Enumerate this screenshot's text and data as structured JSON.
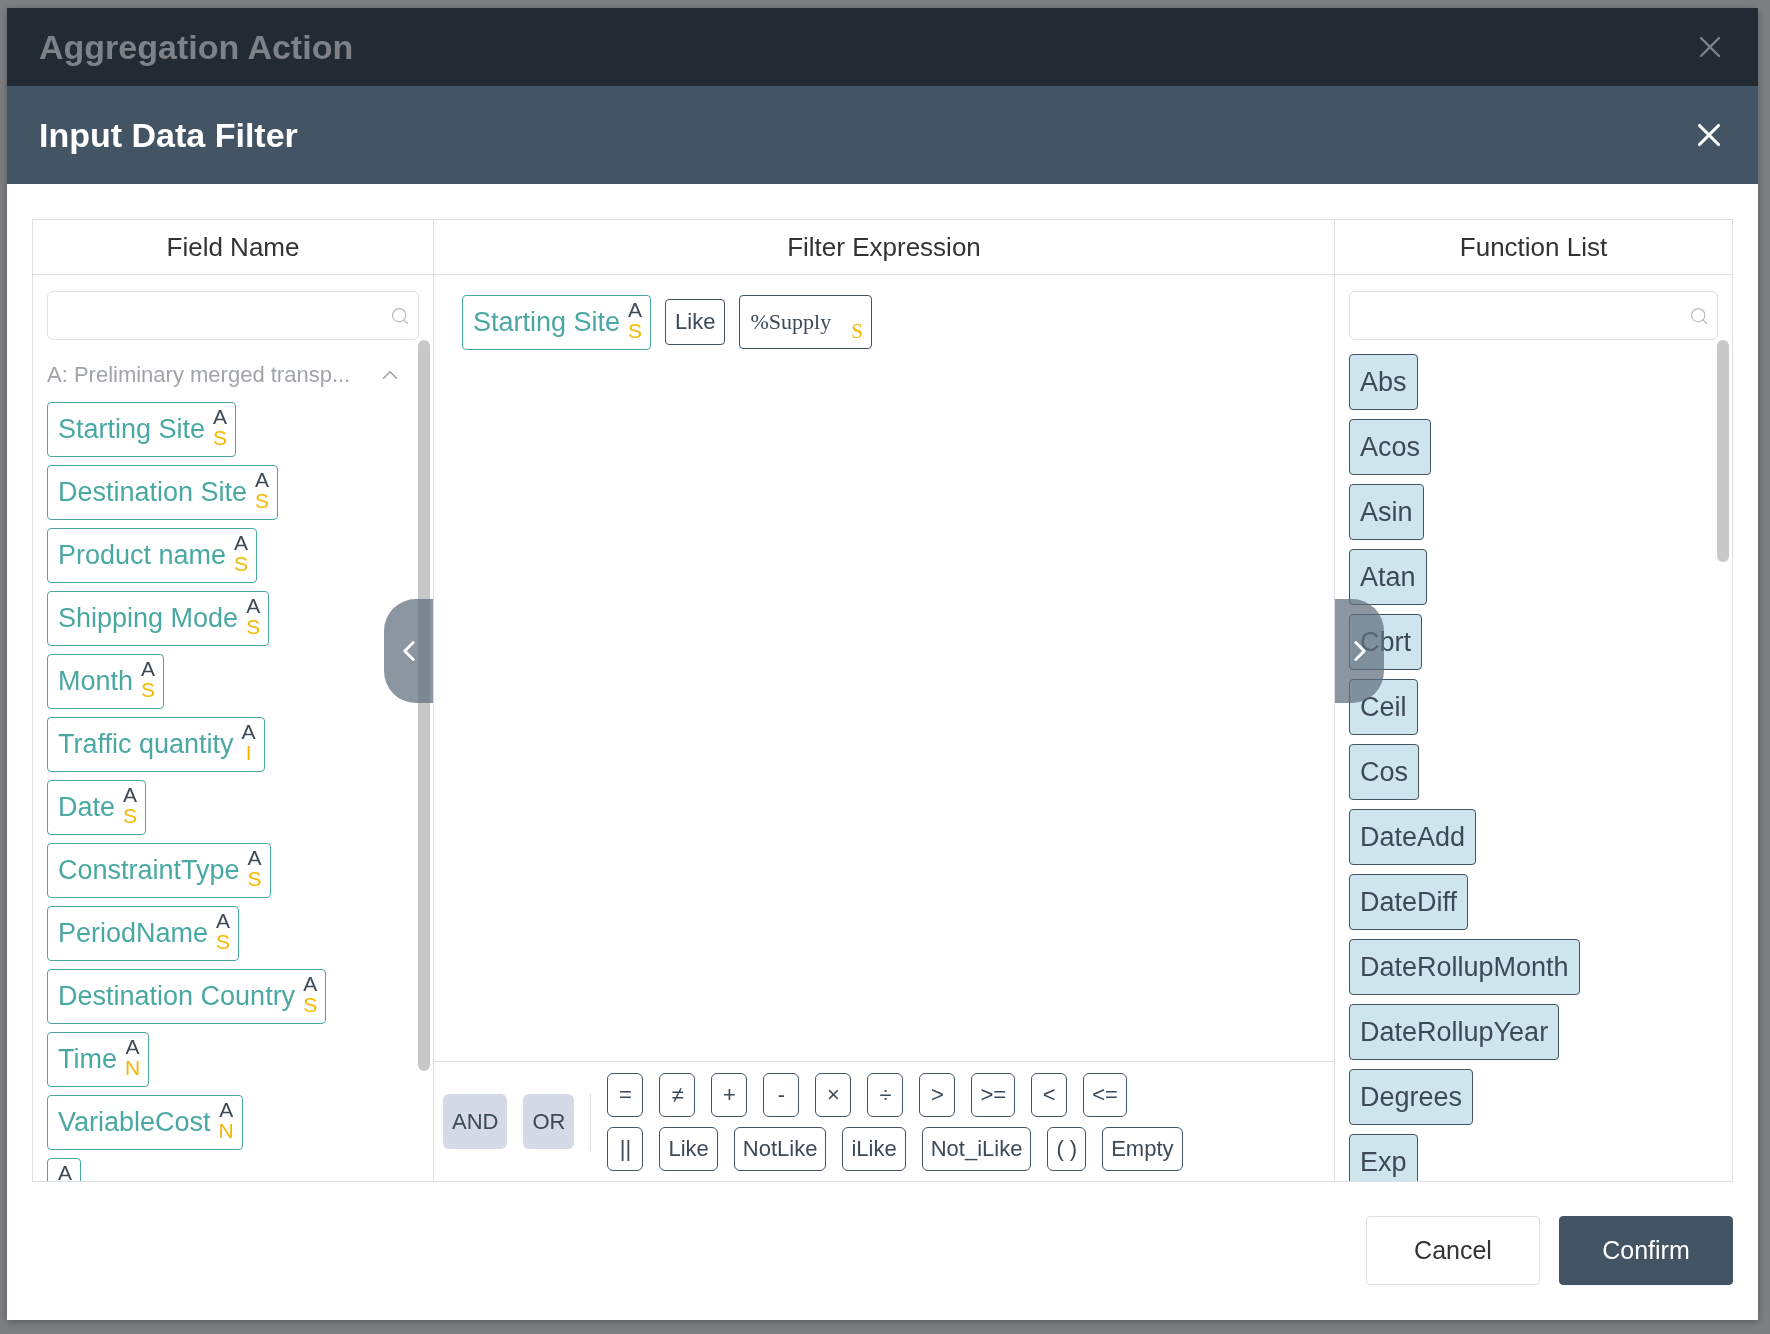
{
  "window": {
    "title": "Aggregation Action"
  },
  "dialog": {
    "title": "Input Data Filter"
  },
  "field_panel": {
    "heading": "Field Name",
    "group": {
      "label": "A: Preliminary merged transp...",
      "expanded": true
    },
    "fields": [
      {
        "name": "Starting Site",
        "source": "A",
        "type": "S"
      },
      {
        "name": "Destination Site",
        "source": "A",
        "type": "S"
      },
      {
        "name": "Product name",
        "source": "A",
        "type": "S"
      },
      {
        "name": "Shipping Mode",
        "source": "A",
        "type": "S"
      },
      {
        "name": "Month",
        "source": "A",
        "type": "S"
      },
      {
        "name": "Traffic quantity",
        "source": "A",
        "type": "I"
      },
      {
        "name": "Date",
        "source": "A",
        "type": "S"
      },
      {
        "name": "ConstraintType",
        "source": "A",
        "type": "S"
      },
      {
        "name": "PeriodName",
        "source": "A",
        "type": "S"
      },
      {
        "name": "Destination Country",
        "source": "A",
        "type": "S"
      },
      {
        "name": "Time",
        "source": "A",
        "type": "N"
      },
      {
        "name": "VariableCost",
        "source": "A",
        "type": "N"
      },
      {
        "source": "A"
      }
    ]
  },
  "expression": {
    "heading": "Filter Expression",
    "tokens": [
      {
        "kind": "field",
        "text": "Starting Site",
        "source": "A",
        "type": "S"
      },
      {
        "kind": "operator",
        "text": "Like"
      },
      {
        "kind": "value",
        "text": "%Supply",
        "type": "S"
      }
    ],
    "logic_buttons": [
      "AND",
      "OR"
    ],
    "operator_rows": [
      [
        "=",
        "≠",
        "+",
        "-",
        "×",
        "÷",
        ">",
        ">=",
        "<",
        "<="
      ],
      [
        "||",
        "Like",
        "NotLike",
        "iLike",
        "Not_iLike",
        "( )",
        "Empty"
      ]
    ]
  },
  "function_panel": {
    "heading": "Function List",
    "functions": [
      "Abs",
      "Acos",
      "Asin",
      "Atan",
      "Cbrt",
      "Ceil",
      "Cos",
      "DateAdd",
      "DateDiff",
      "DateRollupMonth",
      "DateRollupYear",
      "Degrees",
      "Exp"
    ]
  },
  "buttons": [
    {
      "label": "Cancel",
      "kind": "secondary"
    },
    {
      "label": "Confirm",
      "kind": "primary"
    }
  ]
}
